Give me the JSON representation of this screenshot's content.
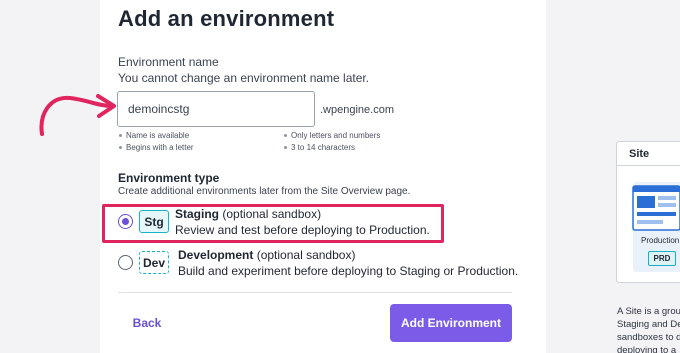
{
  "form": {
    "title": "Add an environment",
    "name_label": "Environment name",
    "name_sub": "You cannot change an environment name later.",
    "name_value": "demoincstg",
    "domain_suffix": ".wpengine.com",
    "hints": {
      "available": "Name is available",
      "letter": "Begins with a letter",
      "chars": "Only letters and numbers",
      "length": "3 to 14 characters"
    },
    "type_heading": "Environment type",
    "type_sub": "Create additional environments later from the Site Overview page.",
    "options": [
      {
        "badge": "Stg",
        "name": "Staging",
        "tag": "(optional sandbox)",
        "desc": "Review and test before deploying to Production.",
        "selected": true
      },
      {
        "badge": "Dev",
        "name": "Development",
        "tag": "(optional sandbox)",
        "desc": "Build and experiment before deploying to Staging or Production.",
        "selected": false
      }
    ],
    "back_label": "Back",
    "submit_label": "Add Environment"
  },
  "side": {
    "card_title": "Site",
    "production_label": "Production",
    "prd_badge": "PRD",
    "text_lines": [
      "A Site is a grou",
      "Staging and De",
      "sandboxes to d",
      "deploying to a"
    ]
  },
  "colors": {
    "accent": "#7b5ce8",
    "highlight": "#e0245e",
    "badge_border": "#19b2c5",
    "arrow": "#e0245e"
  },
  "icons": [
    "annotation-arrow-icon",
    "radio-selected-icon",
    "radio-unselected-icon",
    "site-illustration-icon"
  ]
}
